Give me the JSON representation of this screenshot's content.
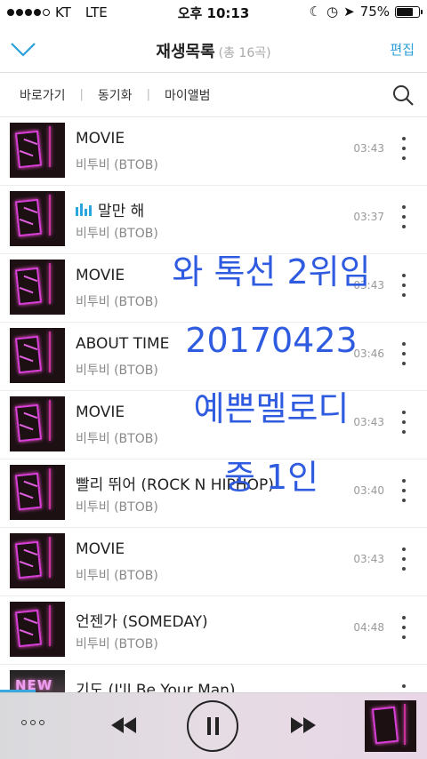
{
  "status_bar": {
    "carrier": "KT",
    "network": "LTE",
    "time": "오후 10:13",
    "battery_percent": "75%",
    "battery_level": 0.75
  },
  "header": {
    "title": "재생목록",
    "count": "(총 16곡)",
    "edit_label": "편집"
  },
  "toolbar": {
    "items": [
      "바로가기",
      "동기화",
      "마이앨범"
    ]
  },
  "songs": [
    {
      "title": "MOVIE",
      "artist": "비투비 (BTOB)",
      "duration": "03:43",
      "playing": false
    },
    {
      "title": "말만 해",
      "artist": "비투비 (BTOB)",
      "duration": "03:37",
      "playing": true
    },
    {
      "title": "MOVIE",
      "artist": "비투비 (BTOB)",
      "duration": "03:43",
      "playing": false
    },
    {
      "title": "ABOUT TIME",
      "artist": "비투비 (BTOB)",
      "duration": "03:46",
      "playing": false
    },
    {
      "title": "MOVIE",
      "artist": "비투비 (BTOB)",
      "duration": "03:43",
      "playing": false
    },
    {
      "title": "빨리 뛰어 (ROCK N HIPHOP)",
      "artist": "비투비 (BTOB)",
      "duration": "03:40",
      "playing": false
    },
    {
      "title": "MOVIE",
      "artist": "비투비 (BTOB)",
      "duration": "03:43",
      "playing": false
    },
    {
      "title": "언젠가 (SOMEDAY)",
      "artist": "비투비 (BTOB)",
      "duration": "04:48",
      "playing": false
    },
    {
      "title": "기도 (I'll Be Your Man)",
      "artist": "",
      "duration": "",
      "playing": false,
      "thumb_text": "NEW"
    }
  ],
  "overlay": {
    "lines": [
      "와 톡선 2위임",
      "20170423",
      "예쁜멜로디",
      "중 1인"
    ]
  },
  "colors": {
    "accent": "#2a9fd8",
    "overlay_text": "#2e5be0"
  }
}
